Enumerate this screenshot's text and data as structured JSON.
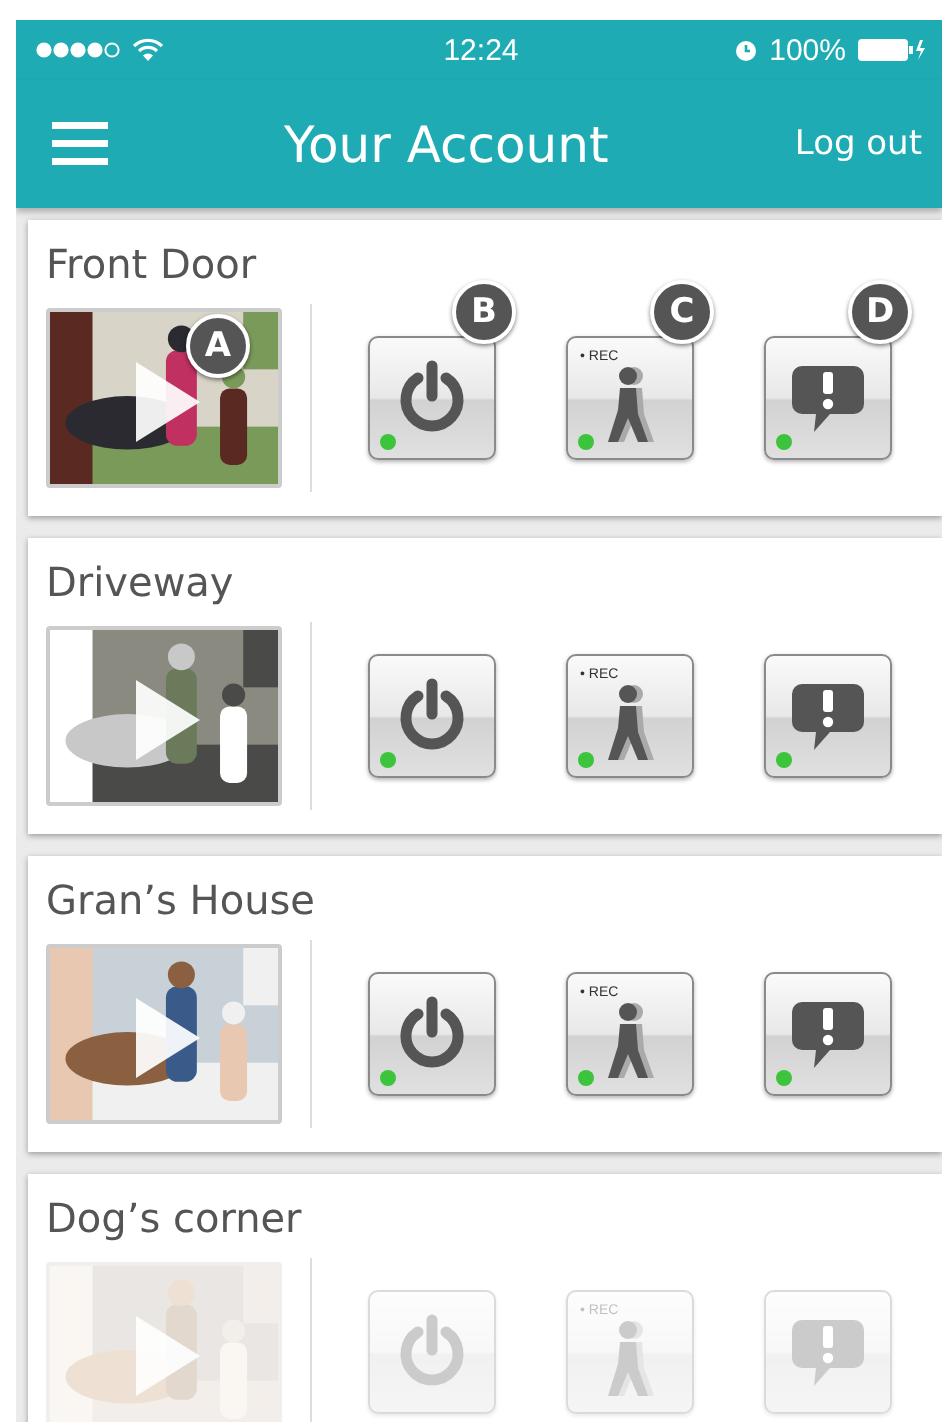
{
  "status_bar": {
    "time": "12:24",
    "battery": "100%"
  },
  "header": {
    "title": "Your Account",
    "action": "Log out"
  },
  "cameras": [
    {
      "name": "Front Door",
      "faded": false,
      "video_badge": "A",
      "controls": [
        {
          "kind": "power",
          "on": true,
          "badge": "B"
        },
        {
          "kind": "motion",
          "on": true,
          "badge": "C",
          "rec_label": "• REC"
        },
        {
          "kind": "alert",
          "on": true,
          "badge": "D"
        }
      ]
    },
    {
      "name": "Driveway",
      "faded": false,
      "controls": [
        {
          "kind": "power",
          "on": true
        },
        {
          "kind": "motion",
          "on": true,
          "rec_label": "• REC"
        },
        {
          "kind": "alert",
          "on": true
        }
      ]
    },
    {
      "name": "Gran’s House",
      "faded": false,
      "controls": [
        {
          "kind": "power",
          "on": true
        },
        {
          "kind": "motion",
          "on": true,
          "rec_label": "• REC"
        },
        {
          "kind": "alert",
          "on": true
        }
      ]
    },
    {
      "name": "Dog’s corner",
      "faded": true,
      "controls": [
        {
          "kind": "power",
          "on": false
        },
        {
          "kind": "motion",
          "on": false,
          "rec_label": "• REC"
        },
        {
          "kind": "alert",
          "on": false
        }
      ]
    }
  ]
}
